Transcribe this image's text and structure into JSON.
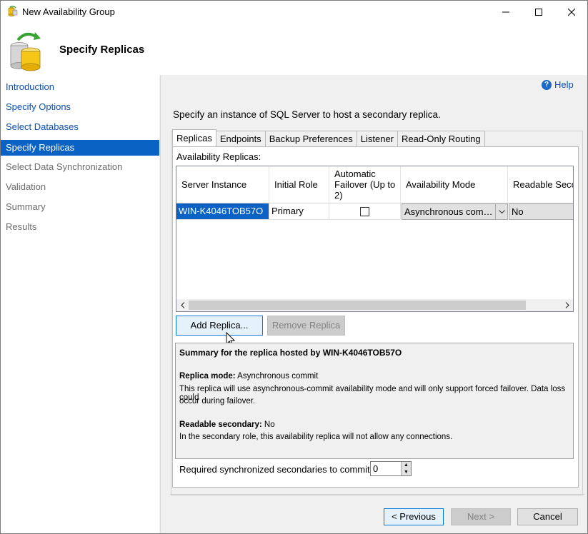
{
  "window": {
    "title": "New Availability Group"
  },
  "header": {
    "title": "Specify Replicas"
  },
  "sidebar": {
    "items": [
      {
        "label": "Introduction",
        "state": "link"
      },
      {
        "label": "Specify Options",
        "state": "link"
      },
      {
        "label": "Select Databases",
        "state": "link"
      },
      {
        "label": "Specify Replicas",
        "state": "selected"
      },
      {
        "label": "Select Data Synchronization",
        "state": "disabled"
      },
      {
        "label": "Validation",
        "state": "disabled"
      },
      {
        "label": "Summary",
        "state": "disabled"
      },
      {
        "label": "Results",
        "state": "disabled"
      }
    ]
  },
  "main": {
    "help_label": "Help",
    "instruction": "Specify an instance of SQL Server to host a secondary replica.",
    "tabs": [
      "Replicas",
      "Endpoints",
      "Backup Preferences",
      "Listener",
      "Read-Only Routing"
    ],
    "grid_label": "Availability Replicas:",
    "grid": {
      "columns": [
        "Server Instance",
        "Initial Role",
        "Automatic Failover (Up to 2)",
        "Availability Mode",
        "Readable Seco"
      ],
      "rows": [
        {
          "server_instance": "WIN-K4046TOB57O",
          "initial_role": "Primary",
          "automatic_failover": false,
          "availability_mode": "Asynchronous com…",
          "readable_secondary": "No"
        }
      ]
    },
    "add_replica_label": "Add Replica...",
    "remove_replica_label": "Remove Replica",
    "summary": {
      "title": "Summary for the replica hosted by WIN-K4046TOB57O",
      "replica_mode_label": "Replica mode:",
      "replica_mode_value": "Asynchronous commit",
      "replica_mode_desc_1": "This replica will use asynchronous-commit availability mode and will only support forced failover. Data loss could",
      "replica_mode_desc_2": "occur during failover.",
      "readable_label": "Readable secondary:",
      "readable_value": "No",
      "readable_desc": "In the secondary role, this availability replica will not allow any connections."
    },
    "required_label": "Required synchronized secondaries to commit",
    "required_value": "0"
  },
  "footer": {
    "previous_label": "< Previous",
    "next_label": "Next >",
    "cancel_label": "Cancel"
  },
  "colors": {
    "accent": "#0a62c4",
    "link": "#0a4fb5"
  }
}
